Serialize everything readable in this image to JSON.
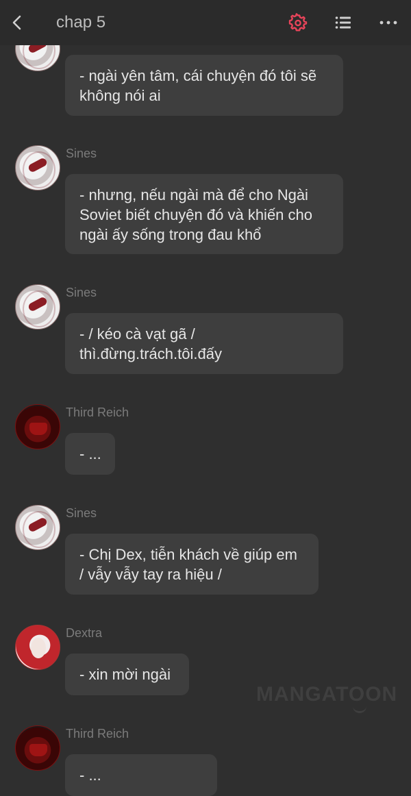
{
  "header": {
    "title": "chap 5",
    "back_icon": "chevron-left-icon",
    "settings_icon": "gear-icon",
    "settings_color": "#e8445a",
    "list_icon": "list-icon",
    "more_icon": "more-dots-icon"
  },
  "messages": [
    {
      "sender": "",
      "lines": [
        "- ngài yên tâm, cái chuyện đó tôi sẽ",
        "không nói ai"
      ]
    },
    {
      "sender": "Sines",
      "lines": [
        "- nhưng, nếu ngài mà để cho Ngài",
        "Soviet biết chuyện đó và khiến cho",
        "ngài ấy sống trong đau khổ"
      ]
    },
    {
      "sender": "Sines",
      "lines": [
        "- / kéo cà vạt gã /",
        "thì.đừng.trách.tôi.đấy"
      ]
    },
    {
      "sender": "Third Reich",
      "lines": [
        "- ..."
      ]
    },
    {
      "sender": "Sines",
      "lines": [
        "- Chị Dex, tiễn khách về giúp em",
        "/ vẫy vẫy tay ra hiệu /"
      ]
    },
    {
      "sender": "Dextra",
      "lines": [
        "- xin mời ngài"
      ]
    },
    {
      "sender": "Third Reich",
      "lines": [
        "- ..."
      ]
    }
  ],
  "watermark": "MANGATOON"
}
